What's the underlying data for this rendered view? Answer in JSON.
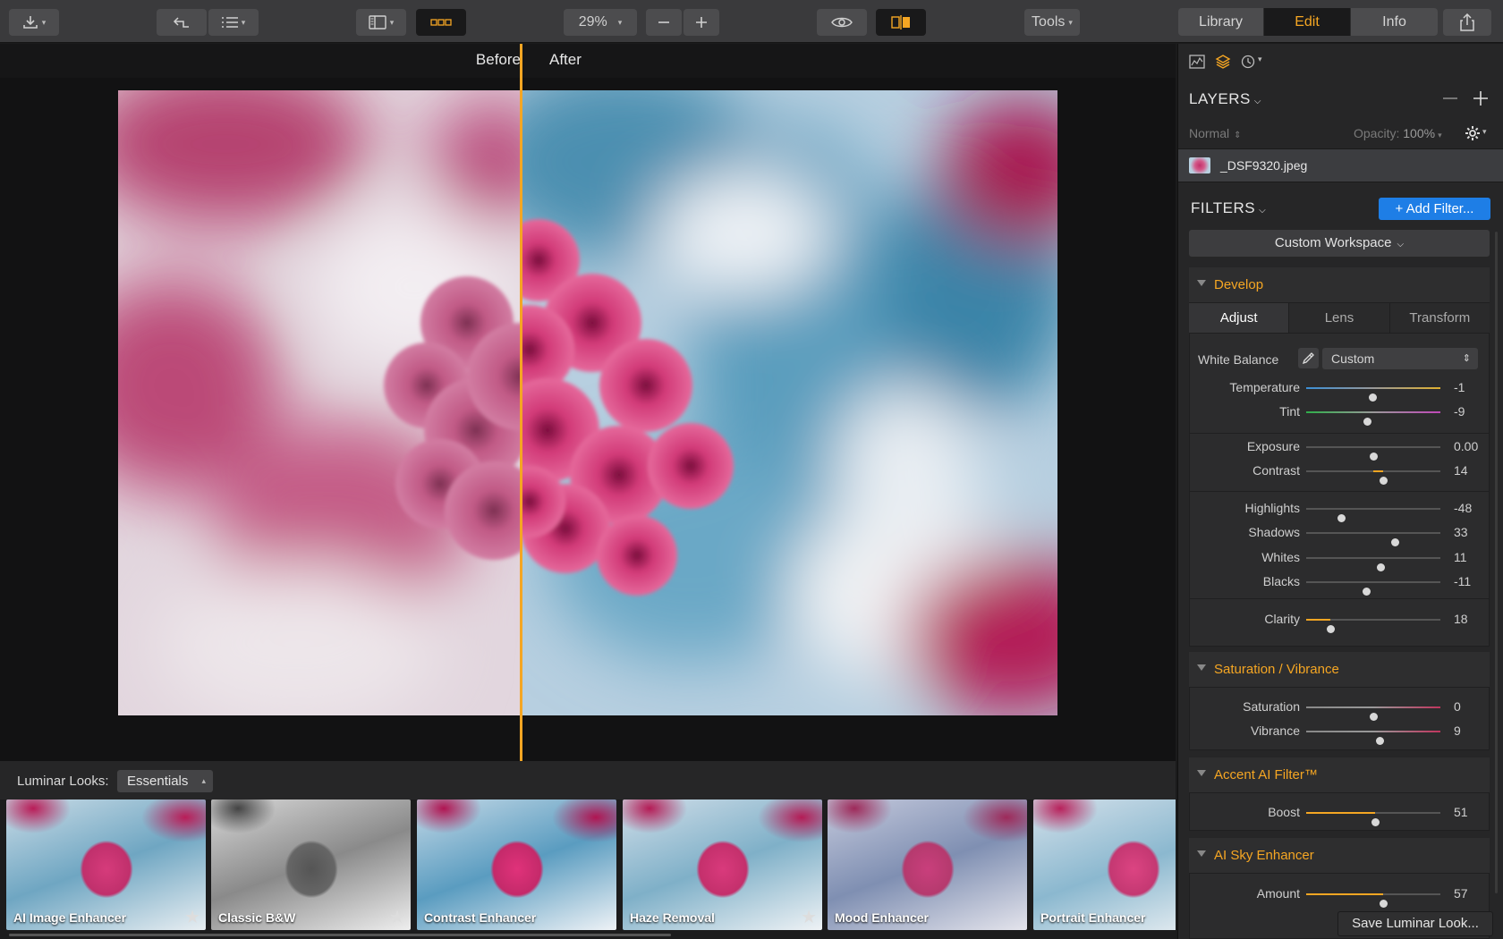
{
  "toolbar": {
    "zoom": "29%",
    "tools_label": "Tools",
    "tabs": [
      "Library",
      "Edit",
      "Info"
    ],
    "active_tab": "Edit"
  },
  "viewer": {
    "before_label": "Before",
    "after_label": "After"
  },
  "looks": {
    "label": "Luminar Looks:",
    "category": "Essentials",
    "items": [
      {
        "name": "AI Image Enhancer",
        "starred": true
      },
      {
        "name": "Classic B&W",
        "starred": true
      },
      {
        "name": "Contrast Enhancer",
        "starred": false
      },
      {
        "name": "Haze Removal",
        "starred": true
      },
      {
        "name": "Mood Enhancer",
        "starred": false
      },
      {
        "name": "Portrait Enhancer",
        "starred": false
      }
    ]
  },
  "panel": {
    "layers_title": "LAYERS",
    "blend_mode": "Normal",
    "opacity_label": "Opacity:",
    "opacity_value": "100%",
    "layer_name": "_DSF9320.jpeg",
    "filters_title": "FILTERS",
    "add_filter": "+ Add Filter...",
    "workspace": "Custom Workspace",
    "save_look": "Save Luminar Look...",
    "develop": {
      "title": "Develop",
      "tabs": [
        "Adjust",
        "Lens",
        "Transform"
      ],
      "white_balance_label": "White Balance",
      "white_balance_value": "Custom",
      "sliders": [
        {
          "label": "Temperature",
          "value": "-1",
          "pos": 0.49,
          "color": "temp"
        },
        {
          "label": "Tint",
          "value": "-9",
          "pos": 0.45,
          "color": "tint"
        },
        {
          "label": "Exposure",
          "value": "0.00",
          "pos": 0.5,
          "color": "plain"
        },
        {
          "label": "Contrast",
          "value": "14",
          "pos": 0.57,
          "color": "plain",
          "fill": true
        },
        {
          "label": "Highlights",
          "value": "-48",
          "pos": 0.26,
          "color": "plain"
        },
        {
          "label": "Shadows",
          "value": "33",
          "pos": 0.66,
          "color": "plain"
        },
        {
          "label": "Whites",
          "value": "11",
          "pos": 0.555,
          "color": "plain"
        },
        {
          "label": "Blacks",
          "value": "-11",
          "pos": 0.445,
          "color": "plain"
        },
        {
          "label": "Clarity",
          "value": "18",
          "pos": 0.18,
          "color": "plain",
          "fill": true
        }
      ]
    },
    "saturation": {
      "title": "Saturation / Vibrance",
      "sliders": [
        {
          "label": "Saturation",
          "value": "0",
          "pos": 0.5,
          "color": "sat"
        },
        {
          "label": "Vibrance",
          "value": "9",
          "pos": 0.545,
          "color": "sat"
        }
      ]
    },
    "accent": {
      "title": "Accent AI Filter™",
      "sliders": [
        {
          "label": "Boost",
          "value": "51",
          "pos": 0.51,
          "color": "plain",
          "fill": true
        }
      ]
    },
    "sky": {
      "title": "AI Sky Enhancer",
      "sliders": [
        {
          "label": "Amount",
          "value": "57",
          "pos": 0.57,
          "color": "plain",
          "fill": true
        }
      ]
    }
  },
  "colors": {
    "accent": "#f5a623",
    "blue_button": "#1e7ee6"
  }
}
